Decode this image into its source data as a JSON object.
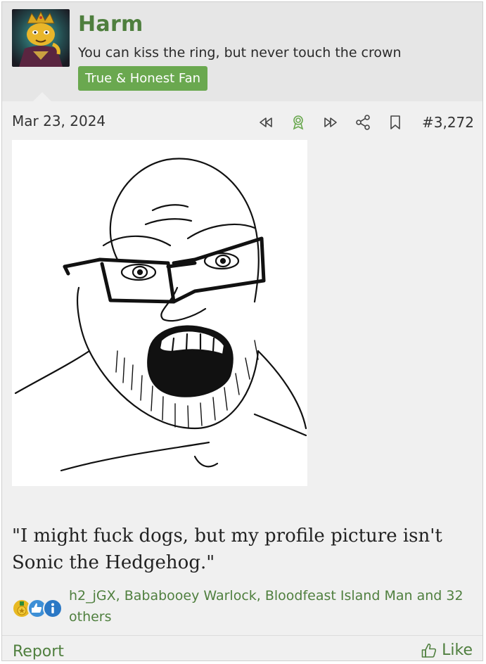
{
  "user": {
    "name": "Harm",
    "title": "You can kiss the ring, but never touch the crown",
    "banner": "True & Honest Fan",
    "avatar_icon": "crowned-figure-avatar"
  },
  "post": {
    "date": "Mar 23, 2024",
    "number": "#3,272",
    "image_description_icon": "soyjak-meme-image",
    "text": "\"I might fuck dogs, but my profile picture isn't Sonic the Hedgehog.\""
  },
  "tools": [
    {
      "icon": "rewind-icon"
    },
    {
      "icon": "award-icon"
    },
    {
      "icon": "fast-forward-icon"
    },
    {
      "icon": "share-icon"
    },
    {
      "icon": "bookmark-icon"
    }
  ],
  "reactions": {
    "icons": [
      "medal-reaction-icon",
      "thumbs-up-reaction-icon",
      "informative-reaction-icon"
    ],
    "summary": "h2_jGX, Bababooey Warlock, Bloodfeast Island Man and 32 others"
  },
  "footer": {
    "report_label": "Report",
    "like_label": "Like"
  },
  "colors": {
    "accent": "#4f7f3e",
    "banner": "#6aa84f",
    "header_bg": "#e6e6e6",
    "post_bg": "#f0f0f0"
  }
}
